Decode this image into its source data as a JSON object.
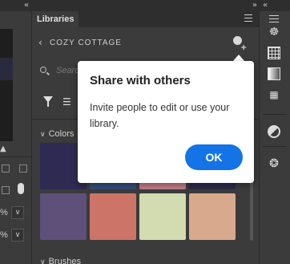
{
  "left_panel": {
    "percent_1": "%",
    "percent_2": "%"
  },
  "libraries_panel": {
    "tab_label": "Libraries",
    "library_name": "COZY COTTAGE",
    "search_placeholder": "Search",
    "colors_section": "Colors",
    "brushes_section": "Brushes",
    "swatches": [
      "#2e2a52",
      "#344a78",
      "#c07a86",
      "#2a2a48",
      "#5e5078",
      "#cd7468",
      "#d3dbb0",
      "#d9a98e"
    ]
  },
  "popup": {
    "title": "Share with others",
    "body": "Invite people to edit or use your library.",
    "ok_label": "OK"
  },
  "icons": {
    "panel_menu": "hamburger-icon",
    "collapse": "double-chevron-icon",
    "share": "person-add-icon",
    "filter": "filter-icon",
    "sort": "sort-icon",
    "search": "search-icon",
    "libraries": "libraries-icon",
    "swatches": "swatches-grid-icon",
    "gradients": "gradient-icon",
    "adjustments": "adjustments-icon",
    "channels": "channels-icon"
  },
  "accent_color": "#1473e6"
}
